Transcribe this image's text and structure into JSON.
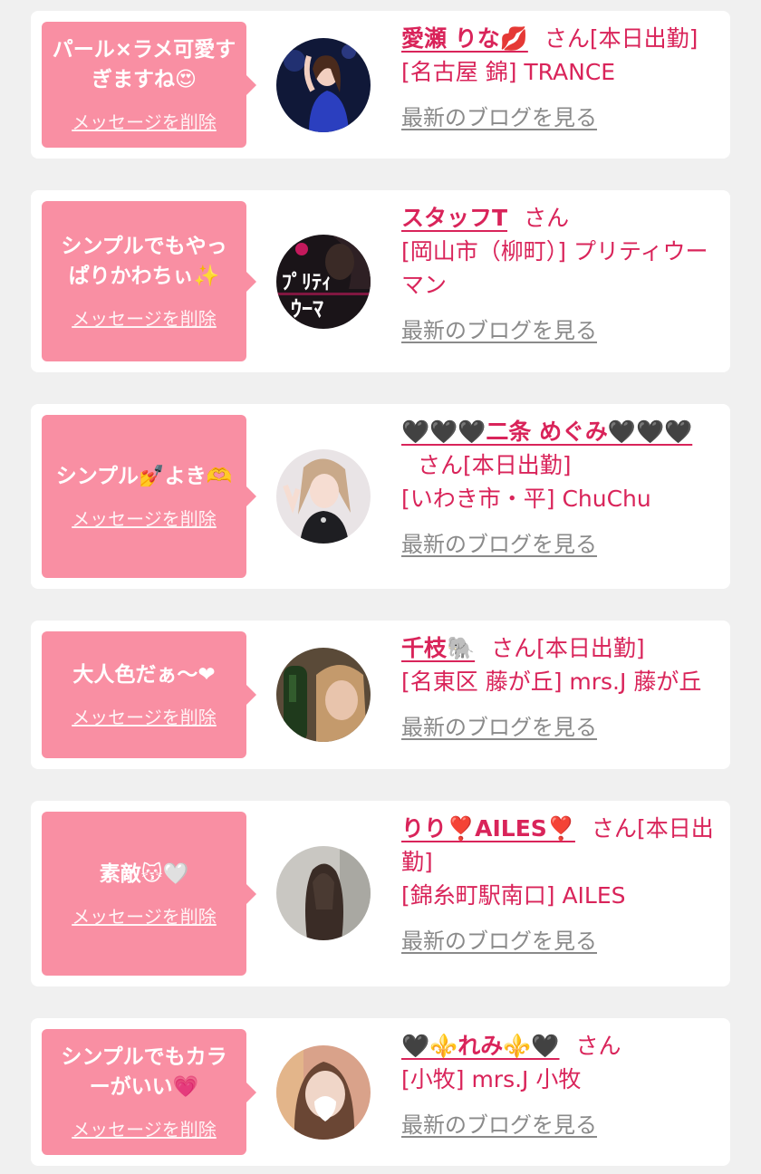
{
  "delete_label": "メッセージを削除",
  "san_suffix": "さん",
  "blog_link": "最新のブログを見る",
  "colors": {
    "accent": "#d9245a",
    "bubble": "#f98fa3",
    "background": "#f0f0f0"
  },
  "cards": [
    {
      "message": "パール×ラメ可愛すぎますね😍",
      "name": "愛瀬 りな💋",
      "status": "[本日出勤]",
      "shop": "[名古屋 錦] TRANCE"
    },
    {
      "message": "シンプルでもやっぱりかわちぃ✨",
      "name": "スタッフT",
      "status": "",
      "shop": "[岡山市（柳町）] プリティウーマン"
    },
    {
      "message": "シンプル💅よき🫶",
      "name": "🖤🖤🖤二条 めぐみ🖤🖤🖤",
      "status": "[本日出勤]",
      "shop": "[いわき市・平] ChuChu"
    },
    {
      "message": "大人色だぁ〜❤",
      "name": "千枝🐘",
      "status": "[本日出勤]",
      "shop": "[名東区 藤が丘] mrs.J 藤が丘"
    },
    {
      "message": "素敵😽🤍",
      "name": "りり❣️AILES❣️",
      "status": "[本日出勤]",
      "shop": "[錦糸町駅南口] AILES"
    },
    {
      "message": "シンプルでもカラーがいい💗",
      "name": "🖤⚜️れみ⚜️🖤",
      "status": "",
      "shop": "[小牧] mrs.J 小牧"
    }
  ]
}
